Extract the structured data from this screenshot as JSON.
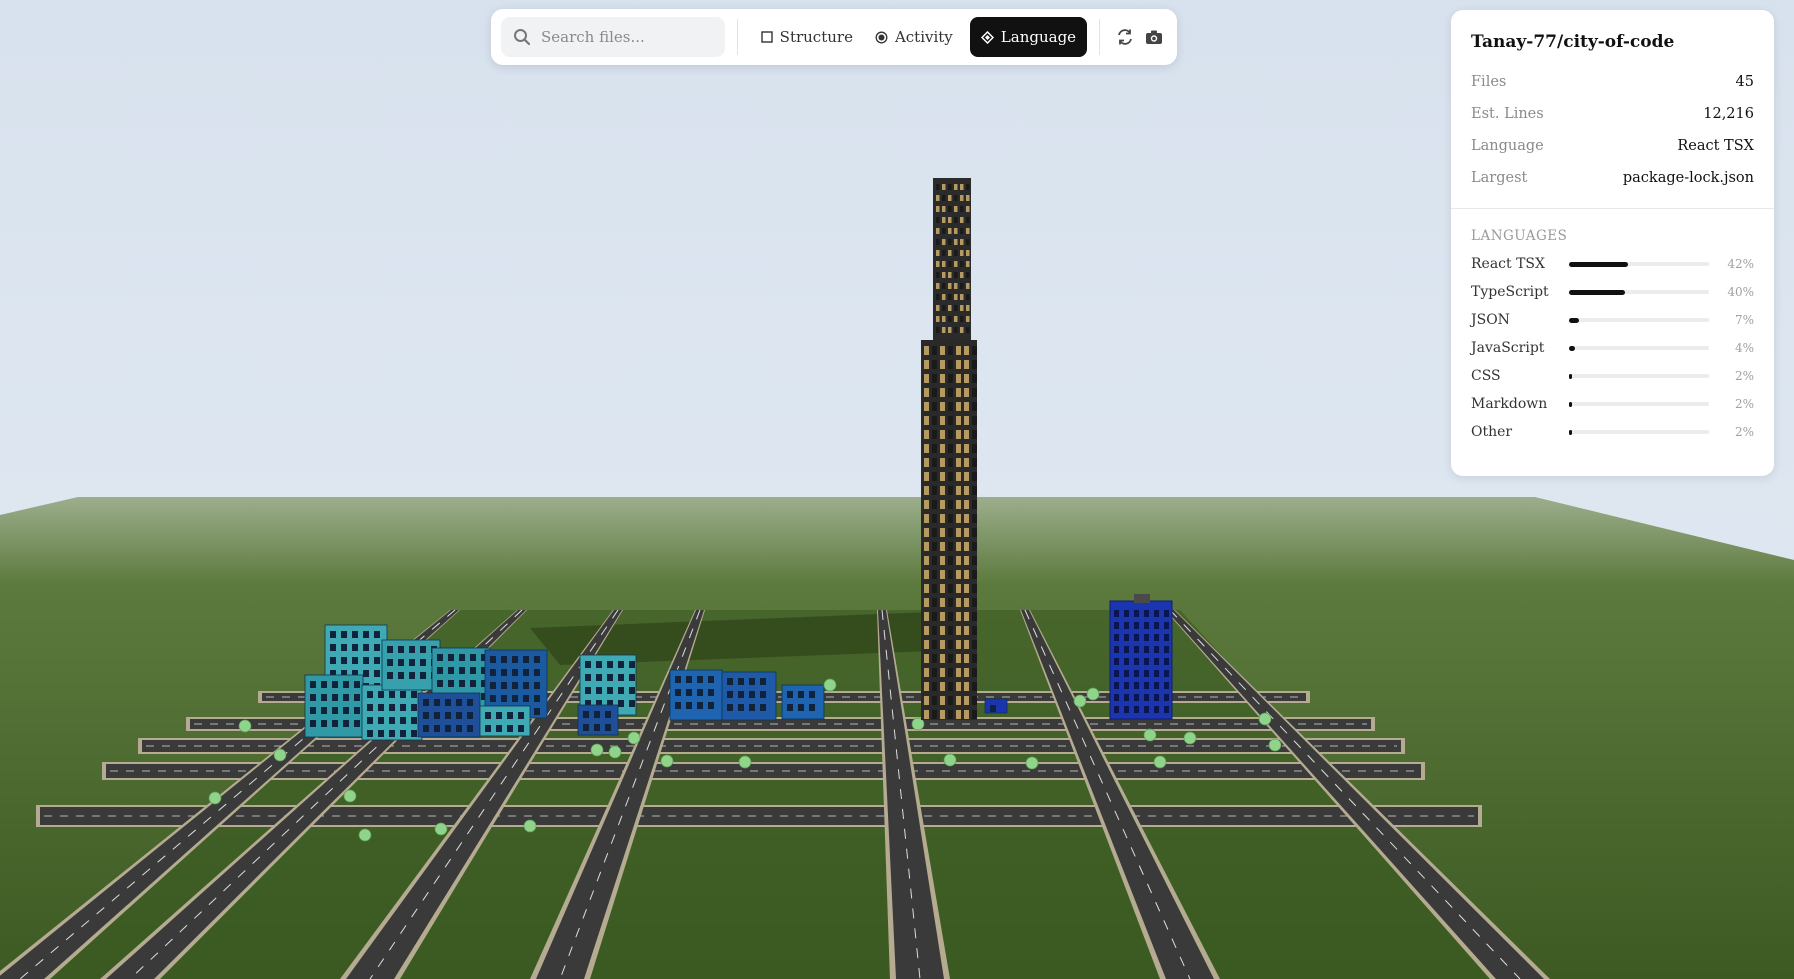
{
  "toolbar": {
    "search_placeholder": "Search files...",
    "search_icon": "search-icon",
    "modes": [
      {
        "label": "Structure",
        "icon": "square-icon",
        "active": false
      },
      {
        "label": "Activity",
        "icon": "radio-icon",
        "active": false
      },
      {
        "label": "Language",
        "icon": "diamond-icon",
        "active": true
      }
    ],
    "actions": [
      {
        "icon": "refresh-icon"
      },
      {
        "icon": "camera-icon"
      }
    ]
  },
  "stats": {
    "repo": "Tanay-77/city-of-code",
    "rows": [
      {
        "label": "Files",
        "value": "45"
      },
      {
        "label": "Est. Lines",
        "value": "12,216"
      },
      {
        "label": "Language",
        "value": "React TSX"
      },
      {
        "label": "Largest",
        "value": "package-lock.json"
      }
    ],
    "languages_title": "LANGUAGES",
    "languages": [
      {
        "name": "React TSX",
        "pct_label": "42%",
        "pct": 42
      },
      {
        "name": "TypeScript",
        "pct_label": "40%",
        "pct": 40
      },
      {
        "name": "JSON",
        "pct_label": "7%",
        "pct": 7
      },
      {
        "name": "JavaScript",
        "pct_label": "4%",
        "pct": 4
      },
      {
        "name": "CSS",
        "pct_label": "2%",
        "pct": 2
      },
      {
        "name": "Markdown",
        "pct_label": "2%",
        "pct": 2
      },
      {
        "name": "Other",
        "pct_label": "2%",
        "pct": 2
      }
    ]
  },
  "colors": {
    "sky": "#dbe4ef",
    "ground": "#4a6b2f",
    "road": "#3a3a3a",
    "tower": "#2a2a2a",
    "tower_window": "#b59a62",
    "building_teal": "#3fa9b4",
    "building_blue": "#1e3fb8",
    "accent_dark": "#111111"
  }
}
